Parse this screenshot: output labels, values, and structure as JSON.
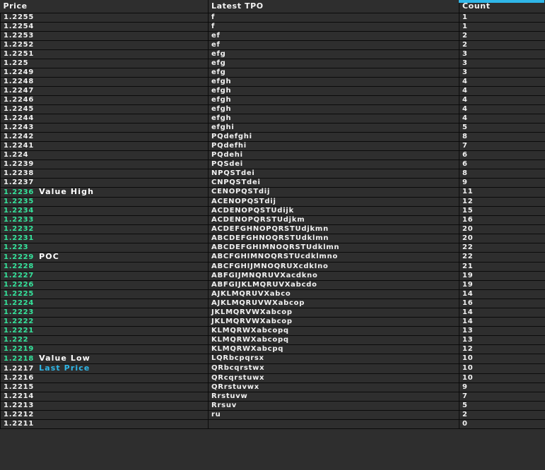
{
  "table": {
    "columns": [
      {
        "key": "price",
        "label": "Price"
      },
      {
        "key": "tpo",
        "label": "Latest TPO"
      },
      {
        "key": "count",
        "label": "Count"
      }
    ],
    "accent_color": "#2fb7e8",
    "value_area_color": "#34e39b",
    "normal_text_color": "#f0f0f0",
    "rows": [
      {
        "price": "1.2255",
        "tpo": "f",
        "count": "1",
        "style": "normal",
        "tag": ""
      },
      {
        "price": "1.2254",
        "tpo": "f",
        "count": "1",
        "style": "normal",
        "tag": ""
      },
      {
        "price": "1.2253",
        "tpo": "ef",
        "count": "2",
        "style": "normal",
        "tag": ""
      },
      {
        "price": "1.2252",
        "tpo": "ef",
        "count": "2",
        "style": "normal",
        "tag": ""
      },
      {
        "price": "1.2251",
        "tpo": "efg",
        "count": "3",
        "style": "normal",
        "tag": ""
      },
      {
        "price": "1.225",
        "tpo": "efg",
        "count": "3",
        "style": "normal",
        "tag": ""
      },
      {
        "price": "1.2249",
        "tpo": "efg",
        "count": "3",
        "style": "normal",
        "tag": ""
      },
      {
        "price": "1.2248",
        "tpo": "efgh",
        "count": "4",
        "style": "normal",
        "tag": ""
      },
      {
        "price": "1.2247",
        "tpo": "efgh",
        "count": "4",
        "style": "normal",
        "tag": ""
      },
      {
        "price": "1.2246",
        "tpo": "efgh",
        "count": "4",
        "style": "normal",
        "tag": ""
      },
      {
        "price": "1.2245",
        "tpo": "efgh",
        "count": "4",
        "style": "normal",
        "tag": ""
      },
      {
        "price": "1.2244",
        "tpo": "efgh",
        "count": "4",
        "style": "normal",
        "tag": ""
      },
      {
        "price": "1.2243",
        "tpo": "efghi",
        "count": "5",
        "style": "normal",
        "tag": ""
      },
      {
        "price": "1.2242",
        "tpo": "PQdefghi",
        "count": "8",
        "style": "normal",
        "tag": ""
      },
      {
        "price": "1.2241",
        "tpo": "PQdefhi",
        "count": "7",
        "style": "normal",
        "tag": ""
      },
      {
        "price": "1.224",
        "tpo": "PQdehi",
        "count": "6",
        "style": "normal",
        "tag": ""
      },
      {
        "price": "1.2239",
        "tpo": "PQSdei",
        "count": "6",
        "style": "normal",
        "tag": ""
      },
      {
        "price": "1.2238",
        "tpo": "NPQSTdei",
        "count": "8",
        "style": "normal",
        "tag": ""
      },
      {
        "price": "1.2237",
        "tpo": "CNPQSTdei",
        "count": "9",
        "style": "normal",
        "tag": ""
      },
      {
        "price": "1.2236",
        "tpo": "CENOPQSTdij",
        "count": "11",
        "style": "value",
        "tag": "Value High",
        "tag_color": "white"
      },
      {
        "price": "1.2235",
        "tpo": "ACENOPQSTdij",
        "count": "12",
        "style": "value",
        "tag": ""
      },
      {
        "price": "1.2234",
        "tpo": "ACDENOPQSTUdijk",
        "count": "15",
        "style": "value",
        "tag": ""
      },
      {
        "price": "1.2233",
        "tpo": "ACDENOPQRSTUdjkm",
        "count": "16",
        "style": "value",
        "tag": ""
      },
      {
        "price": "1.2232",
        "tpo": "ACDEFGHNOPQRSTUdjkmn",
        "count": "20",
        "style": "value",
        "tag": ""
      },
      {
        "price": "1.2231",
        "tpo": "ABCDEFGHNOQRSTUdklmn",
        "count": "20",
        "style": "value",
        "tag": ""
      },
      {
        "price": "1.223",
        "tpo": "ABCDEFGHIMNOQRSTUdklmn",
        "count": "22",
        "style": "value",
        "tag": ""
      },
      {
        "price": "1.2229",
        "tpo": "ABCFGHIMNOQRSTUcdklmno",
        "count": "22",
        "style": "value",
        "tag": "POC",
        "tag_color": "white"
      },
      {
        "price": "1.2228",
        "tpo": "ABCFGHIJMNOQRUXcdkIno",
        "count": "21",
        "style": "value",
        "tag": ""
      },
      {
        "price": "1.2227",
        "tpo": "ABFGIJMNQRUVXacdkno",
        "count": "19",
        "style": "value",
        "tag": ""
      },
      {
        "price": "1.2226",
        "tpo": "ABFGIJKLMQRUVXabcdo",
        "count": "19",
        "style": "value",
        "tag": ""
      },
      {
        "price": "1.2225",
        "tpo": "AJKLMQRUVXabco",
        "count": "14",
        "style": "value",
        "tag": ""
      },
      {
        "price": "1.2224",
        "tpo": "AJKLMQRUVWXabcop",
        "count": "16",
        "style": "value",
        "tag": ""
      },
      {
        "price": "1.2223",
        "tpo": "JKLMQRVWXabcop",
        "count": "14",
        "style": "value",
        "tag": ""
      },
      {
        "price": "1.2222",
        "tpo": "JKLMQRVWXabcop",
        "count": "14",
        "style": "value",
        "tag": ""
      },
      {
        "price": "1.2221",
        "tpo": "KLMQRWXabcopq",
        "count": "13",
        "style": "value",
        "tag": ""
      },
      {
        "price": "1.222",
        "tpo": "KLMQRWXabcopq",
        "count": "13",
        "style": "value",
        "tag": ""
      },
      {
        "price": "1.2219",
        "tpo": "KLMQRWXabcpq",
        "count": "12",
        "style": "value",
        "tag": ""
      },
      {
        "price": "1.2218",
        "tpo": "LQRbcpqrsx",
        "count": "10",
        "style": "value",
        "tag": "Value Low",
        "tag_color": "white"
      },
      {
        "price": "1.2217",
        "tpo": "QRbcqrstwx",
        "count": "10",
        "style": "normal",
        "tag": "Last Price",
        "tag_color": "cyan"
      },
      {
        "price": "1.2216",
        "tpo": "QRcqrstuwx",
        "count": "10",
        "style": "normal",
        "tag": ""
      },
      {
        "price": "1.2215",
        "tpo": "QRrstuvwx",
        "count": "9",
        "style": "normal",
        "tag": ""
      },
      {
        "price": "1.2214",
        "tpo": "Rrstuvw",
        "count": "7",
        "style": "normal",
        "tag": ""
      },
      {
        "price": "1.2213",
        "tpo": "Rrsuv",
        "count": "5",
        "style": "normal",
        "tag": ""
      },
      {
        "price": "1.2212",
        "tpo": "ru",
        "count": "2",
        "style": "normal",
        "tag": ""
      },
      {
        "price": "1.2211",
        "tpo": "",
        "count": "0",
        "style": "normal",
        "tag": ""
      }
    ]
  }
}
